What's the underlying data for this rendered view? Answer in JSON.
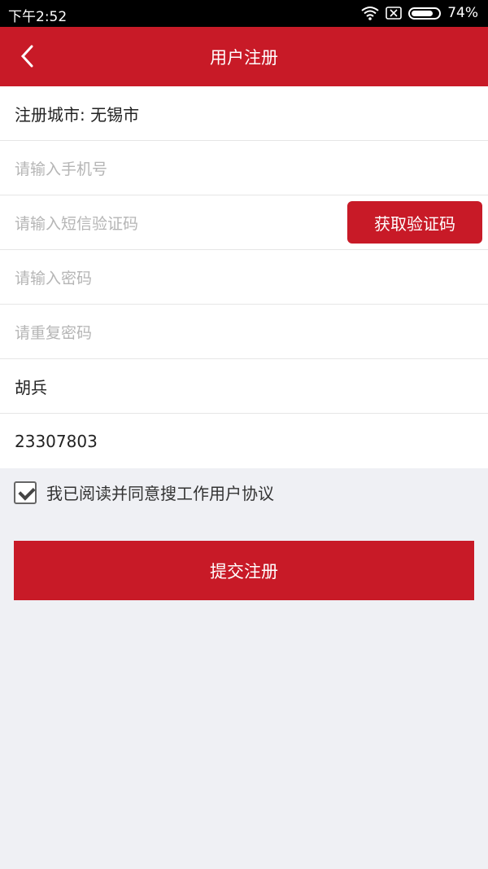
{
  "status": {
    "time": "下午2:52",
    "battery_text": "74%"
  },
  "header": {
    "title": "用户注册"
  },
  "form": {
    "city_label": "注册城市: 无锡市",
    "phone_placeholder": "请输入手机号",
    "sms_placeholder": "请输入短信验证码",
    "get_code_label": "获取验证码",
    "password_placeholder": "请输入密码",
    "repeat_password_placeholder": "请重复密码",
    "name_value": "胡兵",
    "id_value": "23307803"
  },
  "agreement": {
    "checked": true,
    "label": "我已阅读并同意搜工作用户协议"
  },
  "submit": {
    "label": "提交注册"
  },
  "colors": {
    "primary": "#c81a27",
    "background": "#eff0f4"
  }
}
